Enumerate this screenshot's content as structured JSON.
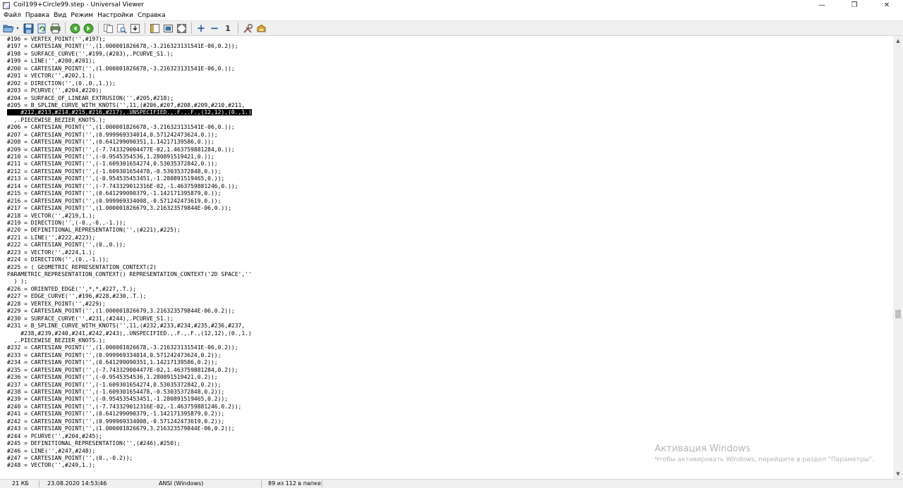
{
  "window": {
    "title": "Coil199+Circle99.step - Universal Viewer",
    "controls": {
      "minimize": "—",
      "maximize": "❐",
      "close": "✕"
    }
  },
  "menu": [
    "Файл",
    "Правка",
    "Вид",
    "Режим",
    "Настройки",
    "Справка"
  ],
  "toolbar": {
    "groups": [
      [
        "open-folder-icon",
        "save-icon",
        "reload-icon",
        "print-icon"
      ],
      [
        "back-arrow-icon",
        "forward-arrow-icon"
      ],
      [
        "copy-icon",
        "find-icon",
        "export-icon"
      ],
      [
        "text-mode-icon",
        "image-mode-icon",
        "fit-window-icon"
      ],
      [
        "zoom-in-icon",
        "zoom-out-icon",
        "original-size-icon"
      ],
      [
        "settings-tools-icon",
        "plugins-icon"
      ]
    ],
    "zoom_in_glyph": "+",
    "zoom_out_glyph": "−",
    "original_size_glyph": "1",
    "dropdown_glyph": "▾"
  },
  "editor": {
    "highlighted_line": 10,
    "lines": [
      "#196 = VERTEX_POINT('',#197);",
      "#197 = CARTESIAN_POINT('',(1.000001826678,-3.216323131541E-06,0.2));",
      "#198 = SURFACE_CURVE('',#199,(#203),.PCURVE_S1.);",
      "#199 = LINE('',#200,#201);",
      "#200 = CARTESIAN_POINT('',(1.000001826678,-3.216323131541E-06,0.));",
      "#201 = VECTOR('',#202,1.);",
      "#202 = DIRECTION('',(0.,0.,1.));",
      "#203 = PCURVE('',#204,#220);",
      "#204 = SURFACE_OF_LINEAR_EXTRUSION('',#205,#218);",
      "#205 = B_SPLINE_CURVE_WITH_KNOTS('',11,(#206,#207,#208,#209,#210,#211,",
      "    #212,#213,#214,#215,#216,#217),.UNSPECIFIED.,.F.,.F.,(12,12),(0.,1.)",
      "  ,.PIECEWISE_BEZIER_KNOTS.);",
      "#206 = CARTESIAN_POINT('',(1.000001826678,-3.216323131541E-06,0.));",
      "#207 = CARTESIAN_POINT('',(0.999969334014,0.571242473624,0.));",
      "#208 = CARTESIAN_POINT('',(0.641299090351,1.14217139586,0.));",
      "#209 = CARTESIAN_POINT('',(-7.743329004477E-02,1.463759881284,0.));",
      "#210 = CARTESIAN_POINT('',(-0.9545354536,1.280891519421,0.));",
      "#211 = CARTESIAN_POINT('',(-1.609301654274,0.53035372842,0.));",
      "#212 = CARTESIAN_POINT('',(-1.609301654478,-0.53035372848,0.));",
      "#213 = CARTESIAN_POINT('',(-0.954535453451,-1.280891519465,0.));",
      "#214 = CARTESIAN_POINT('',(-7.743329012316E-02,-1.463759881246,0.));",
      "#215 = CARTESIAN_POINT('',(0.641299090379,-1.142171395879,0.));",
      "#216 = CARTESIAN_POINT('',(0.999969334008,-0.571242473619,0.));",
      "#217 = CARTESIAN_POINT('',(1.000001826679,3.216323579844E-06,0.));",
      "#218 = VECTOR('',#219,1.);",
      "#219 = DIRECTION('',(-0.,-0.,-1.));",
      "#220 = DEFINITIONAL_REPRESENTATION('',(#221),#225);",
      "#221 = LINE('',#222,#223);",
      "#222 = CARTESIAN_POINT('',(0.,0.));",
      "#223 = VECTOR('',#224,1.);",
      "#224 = DIRECTION('',(0.,-1.));",
      "#225 = ( GEOMETRIC_REPRESENTATION_CONTEXT(2)",
      "PARAMETRIC_REPRESENTATION_CONTEXT() REPRESENTATION_CONTEXT('2D SPACE',''",
      "  ) );",
      "#226 = ORIENTED_EDGE('',*,*,#227,.T.);",
      "#227 = EDGE_CURVE('',#196,#228,#230,.T.);",
      "#228 = VERTEX_POINT('',#229);",
      "#229 = CARTESIAN_POINT('',(1.000001826679,3.216323579844E-06,0.2));",
      "#230 = SURFACE_CURVE('',#231,(#244),.PCURVE_S1.);",
      "#231 = B_SPLINE_CURVE_WITH_KNOTS('',11,(#232,#233,#234,#235,#236,#237,",
      "    #238,#239,#240,#241,#242,#243),.UNSPECIFIED.,.F.,.F.,(12,12),(0.,1.)",
      "  ,.PIECEWISE_BEZIER_KNOTS.);",
      "#232 = CARTESIAN_POINT('',(1.000001826678,-3.216323131541E-06,0.2));",
      "#233 = CARTESIAN_POINT('',(0.999969334014,0.571242473624,0.2));",
      "#234 = CARTESIAN_POINT('',(0.641299090351,1.14217139586,0.2));",
      "#235 = CARTESIAN_POINT('',(-7.743329004477E-02,1.463759881284,0.2));",
      "#236 = CARTESIAN_POINT('',(-0.9545354536,1.280891519421,0.2));",
      "#237 = CARTESIAN_POINT('',(-1.609301654274,0.53035372842,0.2));",
      "#238 = CARTESIAN_POINT('',(-1.609301654478,-0.53035372848,0.2));",
      "#239 = CARTESIAN_POINT('',(-0.954535453451,-1.280891519465,0.2));",
      "#240 = CARTESIAN_POINT('',(-7.743329012316E-02,-1.463759881246,0.2));",
      "#241 = CARTESIAN_POINT('',(0.641299090379,-1.142171395879,0.2));",
      "#242 = CARTESIAN_POINT('',(0.999969334008,-0.571242473619,0.2));",
      "#243 = CARTESIAN_POINT('',(1.000001826679,3.216323579844E-06,0.2));",
      "#244 = PCURVE('',#204,#245);",
      "#245 = DEFINITIONAL_REPRESENTATION('',(#246),#250);",
      "#246 = LINE('',#247,#248);",
      "#247 = CARTESIAN_POINT('',(0.,-0.2));",
      "#248 = VECTOR('',#249,1.);"
    ]
  },
  "scrollbar": {
    "up_glyph": "▲",
    "down_glyph": "▼"
  },
  "watermark": {
    "title": "Активация Windows",
    "subtitle": "Чтобы активировать Windows, перейдите в раздел \"Параметры\"."
  },
  "status": {
    "size": "21 КБ",
    "date": "23.08.2020 14:53:46",
    "encoding": "ANSI (Windows)",
    "position": "89 из 112 в папке"
  },
  "colors": {
    "toolbar_bg": "#f0f0f0",
    "highlight_bg": "#000000",
    "highlight_fg": "#ffffff",
    "watermark": "#b6b6b6"
  }
}
